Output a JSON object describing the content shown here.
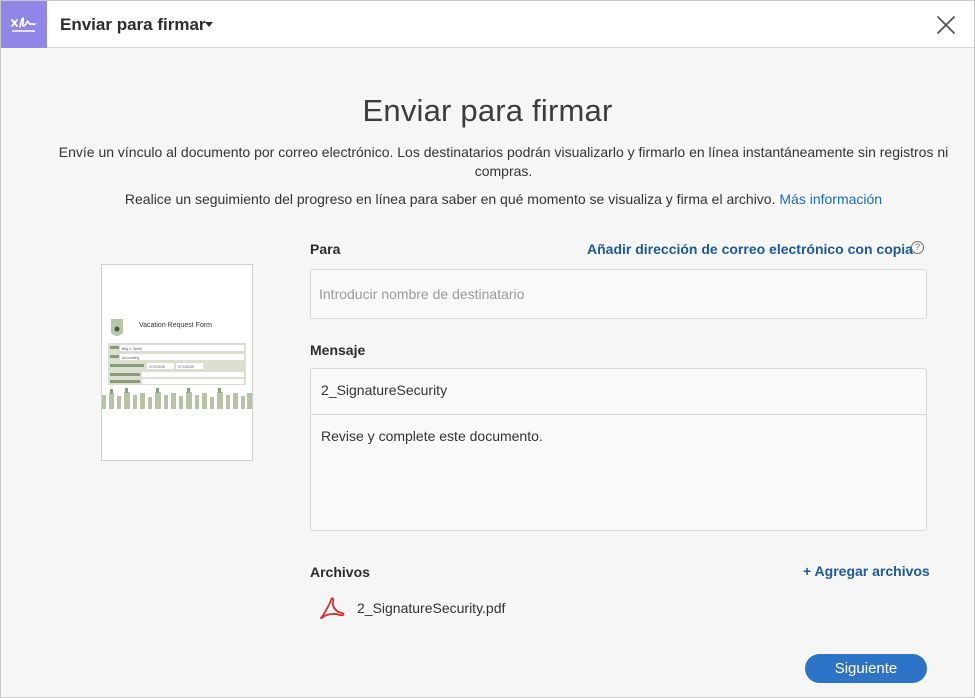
{
  "header": {
    "title": "Enviar para firmar"
  },
  "main": {
    "title": "Enviar para firmar",
    "description1": "Envíe un vínculo al documento por correo electrónico. Los destinatarios podrán visualizarlo y firmarlo en línea instantáneamente sin registros ni compras.",
    "description2": "Realice un seguimiento del progreso en línea para saber en qué momento se visualiza y firma el archivo.",
    "more_info_link": "Más información"
  },
  "thumbnail": {
    "form_title": "Vacation Request Form",
    "field_values": [
      "Billy J. Smith",
      "Accounting",
      "07/10/2019",
      "07/14/2019"
    ]
  },
  "form": {
    "to_label": "Para",
    "cc_link": "Añadir dirección de correo electrónico con copia",
    "recipient_placeholder": "Introducir nombre de destinatario",
    "message_label": "Mensaje",
    "subject": "2_SignatureSecurity",
    "body": "Revise y complete este documento.",
    "files_label": "Archivos",
    "add_files": "+ Agregar archivos",
    "files": [
      {
        "name": "2_SignatureSecurity.pdf",
        "icon": "pdf-icon"
      }
    ],
    "next_button": "Siguiente"
  },
  "colors": {
    "brand": "#8f86e8",
    "link": "#1a5a9c",
    "primary_button": "#2d74c8",
    "pdf_red": "#d3302a"
  }
}
